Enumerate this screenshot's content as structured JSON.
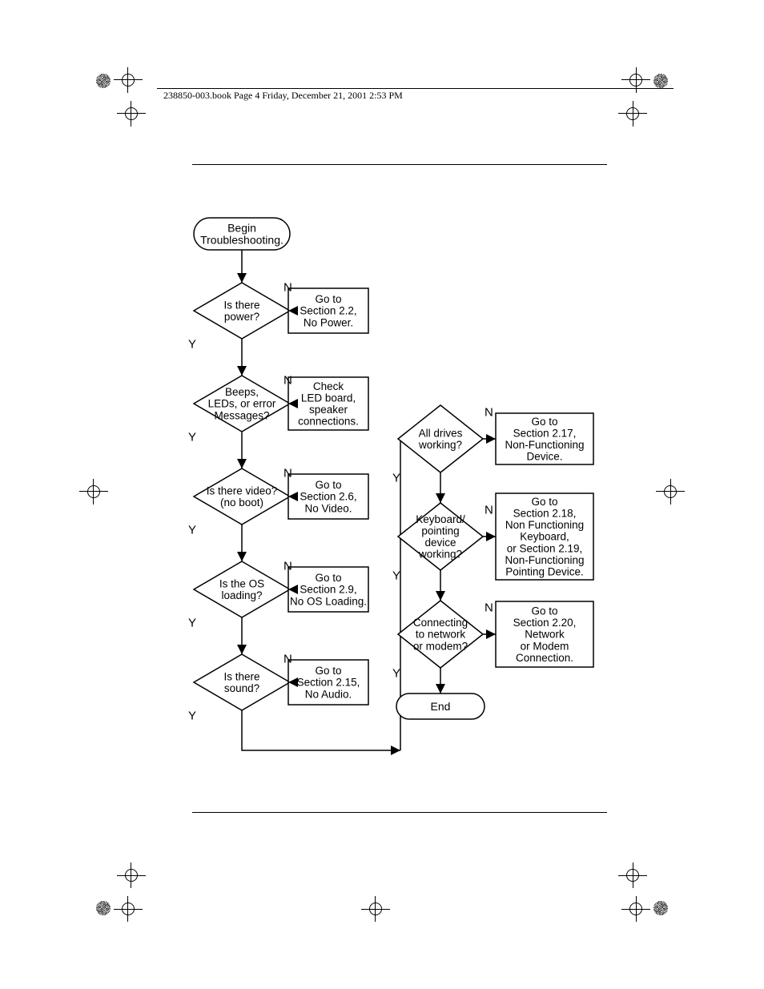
{
  "header": "238850-003.book  Page 4  Friday, December 21, 2001  2:53 PM",
  "start": "Begin\nTroubleshooting.",
  "end": "End",
  "yes": "Y",
  "no": "N",
  "col1": [
    {
      "q": "Is there\npower?",
      "a": "Go to\nSection 2.2,\nNo Power."
    },
    {
      "q": "Beeps,\nLEDs, or error\nMessages?",
      "a": "Check\nLED board,\nspeaker\nconnections."
    },
    {
      "q": "Is there video?\n(no boot)",
      "a": "Go to\nSection 2.6,\nNo Video."
    },
    {
      "q": "Is the OS\nloading?",
      "a": "Go to\nSection 2.9,\nNo OS Loading."
    },
    {
      "q": "Is there\nsound?",
      "a": "Go to\nSection 2.15,\nNo Audio."
    }
  ],
  "col2": [
    {
      "q": "All drives\nworking?",
      "a": "Go to\nSection 2.17,\nNon-Functioning\nDevice."
    },
    {
      "q": "Keyboard/\npointing\ndevice\nworking?",
      "a": "Go to\nSection 2.18,\nNon Functioning\nKeyboard,\nor Section 2.19,\nNon-Functioning\nPointing Device."
    },
    {
      "q": "Connecting\nto network\nor modem?",
      "a": "Go to\nSection 2.20,\nNetwork\nor Modem\nConnection."
    }
  ]
}
